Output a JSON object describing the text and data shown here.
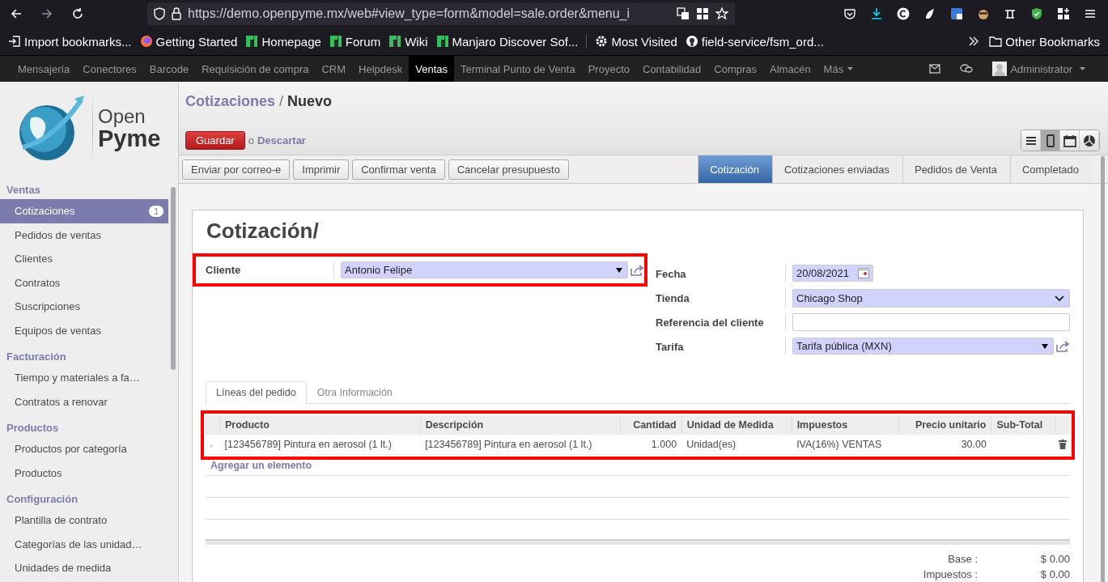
{
  "browser": {
    "url": "https://demo.openpyme.mx/web#view_type=form&model=sale.order&menu_i",
    "bookmarks": [
      {
        "label": "Import bookmarks...",
        "kind": "import"
      },
      {
        "label": "Getting Started",
        "kind": "firefox"
      },
      {
        "label": "Homepage",
        "kind": "manjaro"
      },
      {
        "label": "Forum",
        "kind": "manjaro"
      },
      {
        "label": "Wiki",
        "kind": "manjaro"
      },
      {
        "label": "Manjaro Discover Sof...",
        "kind": "manjaro"
      },
      {
        "label": "Most Visited",
        "kind": "gear"
      },
      {
        "label": "field-service/fsm_ord...",
        "kind": "github"
      }
    ],
    "other_bookmarks": "Other Bookmarks"
  },
  "app_menu": {
    "items": [
      {
        "label": "Mensajería",
        "selected": false
      },
      {
        "label": "Conectores",
        "selected": false
      },
      {
        "label": "Barcode",
        "selected": false
      },
      {
        "label": "Requisición de compra",
        "selected": false
      },
      {
        "label": "CRM",
        "selected": false
      },
      {
        "label": "Helpdesk",
        "selected": false
      },
      {
        "label": "Ventas",
        "selected": true
      },
      {
        "label": "Terminal Punto de Venta",
        "selected": false
      },
      {
        "label": "Proyecto",
        "selected": false
      },
      {
        "label": "Contabilidad",
        "selected": false
      },
      {
        "label": "Compras",
        "selected": false
      },
      {
        "label": "Almacén",
        "selected": false
      }
    ],
    "more": "Más",
    "user": "Administrator"
  },
  "logo": {
    "line1": "Open",
    "line2": "Pyme"
  },
  "sidebar": [
    {
      "title": "Ventas",
      "items": [
        {
          "label": "Cotizaciones",
          "selected": true,
          "badge": "1"
        },
        {
          "label": "Pedidos de ventas",
          "selected": false
        },
        {
          "label": "Clientes",
          "selected": false
        },
        {
          "label": "Contratos",
          "selected": false
        },
        {
          "label": "Suscripciones",
          "selected": false
        },
        {
          "label": "Equipos de ventas",
          "selected": false
        }
      ]
    },
    {
      "title": "Facturación",
      "items": [
        {
          "label": "Tiempo y materiales a fa…",
          "selected": false
        },
        {
          "label": "Contratos a renovar",
          "selected": false
        }
      ]
    },
    {
      "title": "Productos",
      "items": [
        {
          "label": "Productos por categoría",
          "selected": false
        },
        {
          "label": "Productos",
          "selected": false
        }
      ]
    },
    {
      "title": "Configuración",
      "items": [
        {
          "label": "Plantilla de contrato",
          "selected": false
        },
        {
          "label": "Categorías de las unidad…",
          "selected": false
        },
        {
          "label": "Unidades de medida",
          "selected": false
        }
      ]
    }
  ],
  "breadcrumb": {
    "parent": "Cotizaciones",
    "separator": "/",
    "current": "Nuevo"
  },
  "save_button": "Guardar",
  "or_text": "o",
  "discard_link": "Descartar",
  "views": [
    {
      "kind": "list",
      "selected": false
    },
    {
      "kind": "form",
      "selected": true
    },
    {
      "kind": "calendar",
      "selected": false
    },
    {
      "kind": "graph",
      "selected": false
    }
  ],
  "actions": [
    "Enviar por correo-e",
    "Imprimir",
    "Confirmar venta",
    "Cancelar presupuesto"
  ],
  "status_steps": [
    {
      "label": "Cotización",
      "selected": true
    },
    {
      "label": "Cotizaciones enviadas",
      "selected": false
    },
    {
      "label": "Pedidos de Venta",
      "selected": false
    },
    {
      "label": "Completado",
      "selected": false
    }
  ],
  "form": {
    "title": "Cotización/",
    "left_fields": [
      {
        "label": "Cliente",
        "value": "Antonio Felipe",
        "kind": "many2one",
        "highlighted": true
      }
    ],
    "right_fields": [
      {
        "label": "Fecha",
        "value": "20/08/2021",
        "kind": "date"
      },
      {
        "label": "Tienda",
        "value": "Chicago Shop",
        "kind": "select"
      },
      {
        "label": "Referencia del cliente",
        "kind": "text"
      },
      {
        "label": "Tarifa",
        "value": "Tarifa pública (MXN)",
        "kind": "many2one"
      }
    ],
    "tabs": [
      {
        "label": "Líneas del pedido",
        "selected": true
      },
      {
        "label": "Otra Información",
        "selected": false
      }
    ],
    "order_lines": {
      "highlighted": true,
      "columns": [
        "Producto",
        "Descripción",
        "Cantidad",
        "Unidad de Medida",
        "Impuestos",
        "Precio unitario",
        "Sub-Total"
      ],
      "rows": [
        [
          "[123456789] Pintura en aerosol (1 lt.)",
          "[123456789] Pintura en aerosol (1 lt.)",
          "1.000",
          "Unidad(es)",
          "IVA(16%) VENTAS",
          "30.00",
          ""
        ]
      ]
    },
    "add_item": "Agregar un elemento",
    "totals": [
      {
        "label": "Base :",
        "value": "$ 0.00"
      },
      {
        "label": "Impuestos :",
        "value": "$ 0.00"
      }
    ]
  }
}
